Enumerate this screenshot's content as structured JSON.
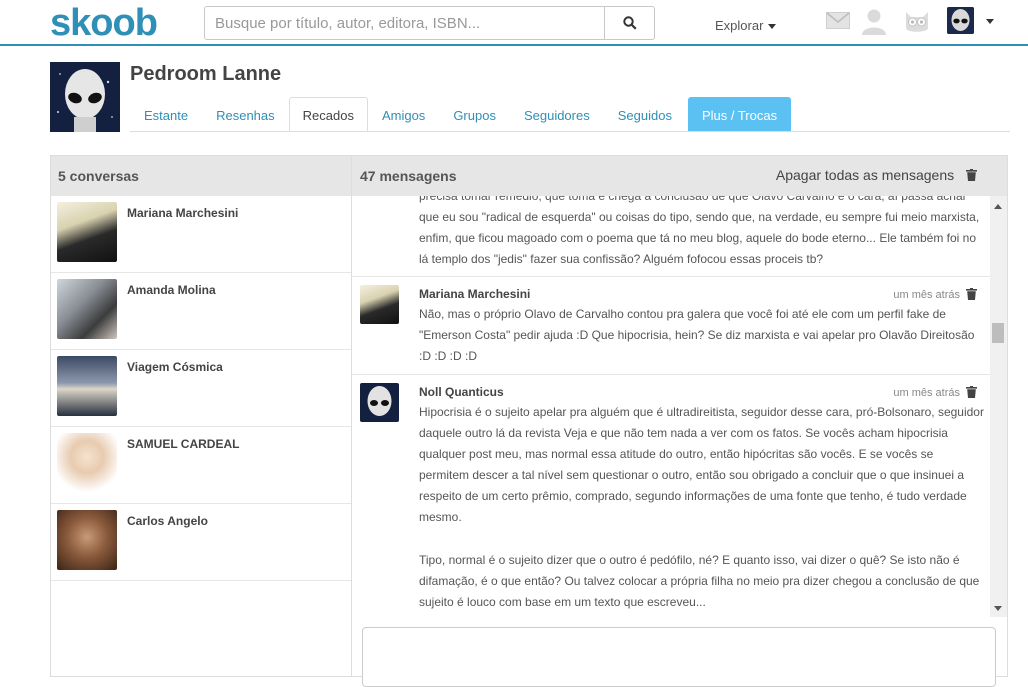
{
  "header": {
    "logo": "skoob",
    "search_placeholder": "Busque por título, autor, editora, ISBN...",
    "explore_label": "Explorar"
  },
  "profile": {
    "name": "Pedroom Lanne",
    "tabs": [
      "Estante",
      "Resenhas",
      "Recados",
      "Amigos",
      "Grupos",
      "Seguidores",
      "Seguidos",
      "Plus / Trocas"
    ],
    "active_tab": "Recados"
  },
  "conversations": {
    "header": "5 conversas",
    "items": [
      {
        "name": "Mariana Marchesini"
      },
      {
        "name": "Amanda Molina"
      },
      {
        "name": "Viagem Cósmica"
      },
      {
        "name": "SAMUEL CARDEAL"
      },
      {
        "name": "Carlos Angelo"
      }
    ]
  },
  "messages": {
    "header": "47 mensagens",
    "delete_all": "Apagar todas as mensagens",
    "partial_top": "precisa tomar remédio, que toma e chega à conclusão de que Olavo Carvalho é o cara, aí passa achar que eu sou \"radical de esquerda\" ou coisas do tipo, sendo que, na verdade, eu sempre fui meio marxista, enfim, que ficou magoado com o poema que tá no meu blog, aquele do bode eterno... Ele também foi no lá templo dos \"jedis\" fazer sua confissão? Alguém fofocou essas proceis tb?",
    "items": [
      {
        "author": "Mariana Marchesini",
        "time": "um mês atrás",
        "body": "Não, mas o próprio Olavo de Carvalho contou pra galera que você foi até ele com um perfil fake de \"Emerson Costa\" pedir ajuda :D Que hipocrisia, hein? Se diz marxista e vai apelar pro Olavão Direitosão :D :D :D :D"
      },
      {
        "author": "Noll Quanticus",
        "time": "um mês atrás",
        "body": "Hipocrisia é o sujeito apelar pra alguém que é ultradireitista, seguidor desse cara, pró-Bolsonaro, seguidor daquele outro lá da revista Veja e que não tem nada a ver com os fatos. Se vocês acham hipocrisia qualquer post meu, mas normal essa atitude do outro, então hipócritas são vocês. E se vocês se permitem descer a tal nível sem questionar o outro, então sou obrigado a concluir que o que insinuei a respeito de um certo prêmio, comprado, segundo informações de uma fonte que tenho, é tudo verdade mesmo.",
        "body2": "Tipo, normal é o sujeito dizer que o outro é pedófilo, né? E quanto isso, vai dizer o quê? Se isto não é difamação, é o que então? Ou talvez colocar a própria filha no meio pra dizer chegou a conclusão de que sujeito é louco com base em um texto que escreveu..."
      }
    ]
  },
  "colors": {
    "brand": "#2f8fb6",
    "plus_tab": "#5bc0f2"
  },
  "icons": [
    "search-icon",
    "mail-icon",
    "user-icon",
    "owl-icon",
    "trash-icon",
    "chevron-down-icon"
  ]
}
